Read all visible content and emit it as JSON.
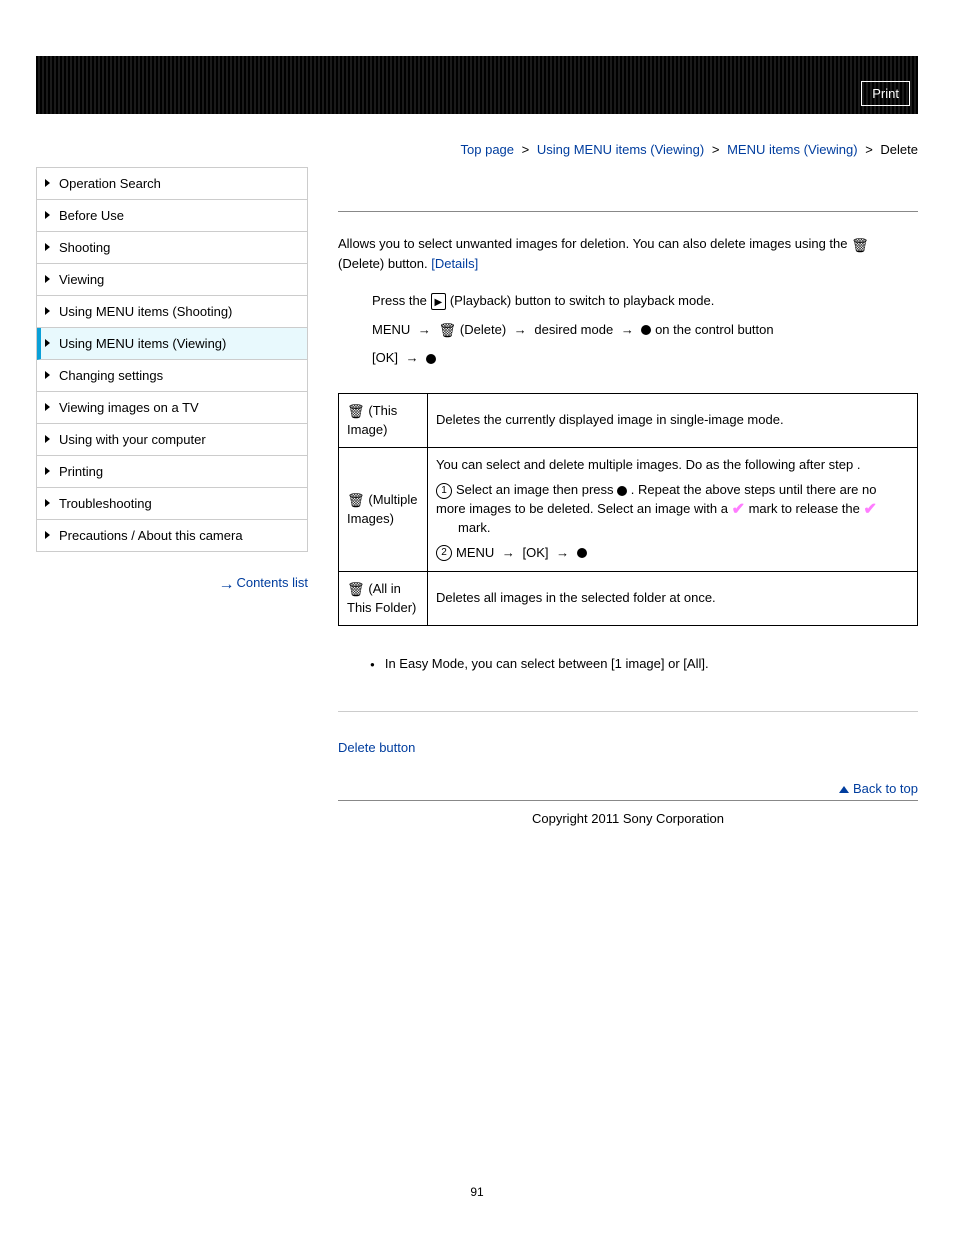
{
  "topbar": {
    "print_label": "Print"
  },
  "breadcrumb": {
    "items": [
      "Top page",
      "Using MENU items (Viewing)",
      "MENU items (Viewing)"
    ],
    "current": "Delete",
    "sep": ">"
  },
  "sidebar": {
    "items": [
      {
        "label": "Operation Search",
        "selected": false
      },
      {
        "label": "Before Use",
        "selected": false
      },
      {
        "label": "Shooting",
        "selected": false
      },
      {
        "label": "Viewing",
        "selected": false
      },
      {
        "label": "Using MENU items (Shooting)",
        "selected": false
      },
      {
        "label": "Using MENU items (Viewing)",
        "selected": true
      },
      {
        "label": "Changing settings",
        "selected": false
      },
      {
        "label": "Viewing images on a TV",
        "selected": false
      },
      {
        "label": "Using with your computer",
        "selected": false
      },
      {
        "label": "Printing",
        "selected": false
      },
      {
        "label": "Troubleshooting",
        "selected": false
      },
      {
        "label": "Precautions / About this camera",
        "selected": false
      }
    ],
    "contents_label": "Contents list"
  },
  "content": {
    "intro_a": "Allows you to select unwanted images for deletion. You can also delete images using the ",
    "intro_b": " (Delete) button. ",
    "details_label": "[Details]",
    "step1_a": "Press the ",
    "step1_b": " (Playback) button to switch to playback mode.",
    "step2_menu": "MENU",
    "step2_delete": " (Delete)",
    "step2_desired": " desired mode",
    "step2_on_btn": " on the control button",
    "step3_ok": "[OK]",
    "table": {
      "row1": {
        "label": " (This Image)",
        "desc": "Deletes the currently displayed image in single-image mode."
      },
      "row2": {
        "label": " (Multiple Images)",
        "line1": "You can select and delete multiple images. Do as the following after step   .",
        "li1_a": "Select an image then press ",
        "li1_b": " . Repeat the above steps until there are no more images to be deleted. Select an image with a ",
        "li1_c": " mark to release the ",
        "li1_d": " mark.",
        "li2_a": "MENU",
        "li2_b": " [OK]"
      },
      "row3": {
        "label": " (All in This Folder)",
        "desc": "Deletes all images in the selected folder at once."
      }
    },
    "note1": "In Easy Mode, you can select between [1 image] or [All].",
    "related_label": "Delete button",
    "backtotop_label": "Back to top",
    "copyright": "Copyright 2011 Sony Corporation",
    "pagenum": "91"
  }
}
